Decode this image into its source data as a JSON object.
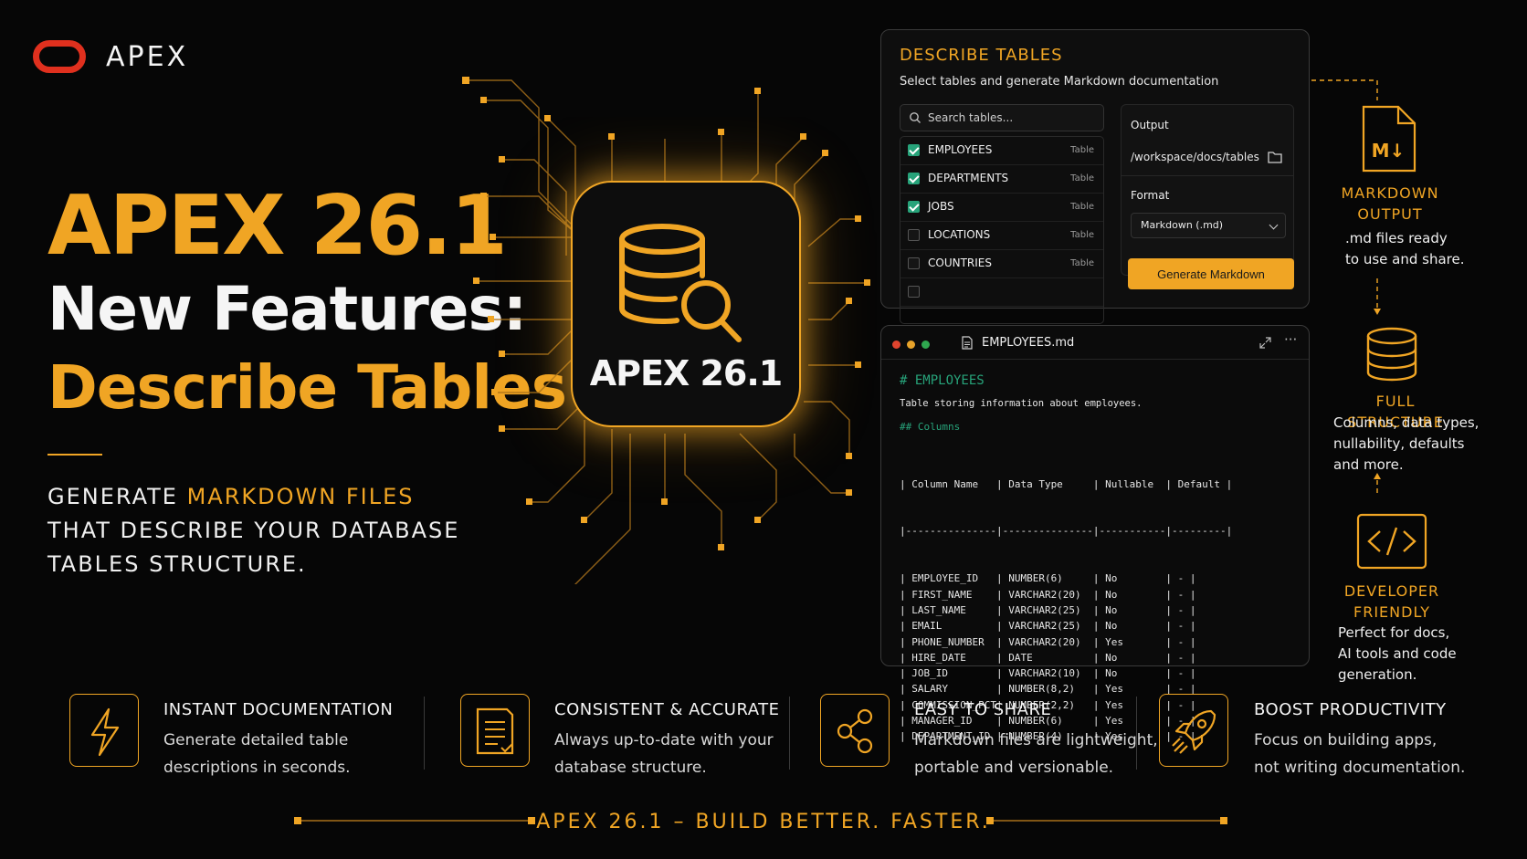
{
  "brand": {
    "logo_text": "APEX"
  },
  "hero": {
    "line1": "APEX 26.1",
    "line2": "New Features:",
    "line3": "Describe Tables",
    "subhead": {
      "l1_pre": "GENERATE ",
      "l1_accent": "MARKDOWN FILES",
      "l2": "THAT DESCRIBE YOUR DATABASE",
      "l3": "TABLES STRUCTURE."
    }
  },
  "chip": {
    "label": "APEX 26.1",
    "icon": "database-search-icon"
  },
  "describe_panel": {
    "title": "DESCRIBE TABLES",
    "subtitle": "Select tables and generate Markdown documentation",
    "search_placeholder": "Search tables...",
    "tables": [
      {
        "name": "EMPLOYEES",
        "type": "Table",
        "checked": true
      },
      {
        "name": "DEPARTMENTS",
        "type": "Table",
        "checked": true
      },
      {
        "name": "JOBS",
        "type": "Table",
        "checked": true
      },
      {
        "name": "LOCATIONS",
        "type": "Table",
        "checked": false
      },
      {
        "name": "COUNTRIES",
        "type": "Table",
        "checked": false
      }
    ],
    "output_label": "Output",
    "output_path": "/workspace/docs/tables",
    "format_label": "Format",
    "format_value": "Markdown (.md)",
    "generate_label": "Generate Markdown"
  },
  "md_panel": {
    "filename": "EMPLOYEES.md",
    "heading": "# EMPLOYEES",
    "description": "Table storing information about employees.",
    "subheading": "## Columns",
    "header_line": "| Column Name   | Data Type     | Nullable  | Default |",
    "separator_line": "|---------------|---------------|-----------|---------|",
    "rows": [
      {
        "name": "EMPLOYEE_ID",
        "type": "NUMBER(6)",
        "nullable": "No",
        "default": "-"
      },
      {
        "name": "FIRST_NAME",
        "type": "VARCHAR2(20)",
        "nullable": "No",
        "default": "-"
      },
      {
        "name": "LAST_NAME",
        "type": "VARCHAR2(25)",
        "nullable": "No",
        "default": "-"
      },
      {
        "name": "EMAIL",
        "type": "VARCHAR2(25)",
        "nullable": "No",
        "default": "-"
      },
      {
        "name": "PHONE_NUMBER",
        "type": "VARCHAR2(20)",
        "nullable": "Yes",
        "default": "-"
      },
      {
        "name": "HIRE_DATE",
        "type": "DATE",
        "nullable": "No",
        "default": "-"
      },
      {
        "name": "JOB_ID",
        "type": "VARCHAR2(10)",
        "nullable": "No",
        "default": "-"
      },
      {
        "name": "SALARY",
        "type": "NUMBER(8,2)",
        "nullable": "Yes",
        "default": "-"
      },
      {
        "name": "COMMISSION_PCT",
        "type": "NUMBER(2,2)",
        "nullable": "Yes",
        "default": "-"
      },
      {
        "name": "MANAGER_ID",
        "type": "NUMBER(6)",
        "nullable": "Yes",
        "default": "-"
      },
      {
        "name": "DEPARTMENT_ID",
        "type": "NUMBER(4)",
        "nullable": "Yes",
        "default": "-"
      }
    ]
  },
  "rail": [
    {
      "title_l1": "MARKDOWN",
      "title_l2": "OUTPUT",
      "desc": [
        ".md files ready",
        "to use and share."
      ],
      "icon": "markdown-file-icon"
    },
    {
      "title_l1": "FULL STRUCTURE",
      "title_l2": "",
      "desc": [
        "Columns, data types,",
        "nullability, defaults",
        "and more."
      ],
      "icon": "database-icon"
    },
    {
      "title_l1": "DEVELOPER",
      "title_l2": "FRIENDLY",
      "desc": [
        "Perfect for docs,",
        "AI tools and code",
        "generation."
      ],
      "icon": "code-icon"
    }
  ],
  "features": [
    {
      "title": "INSTANT DOCUMENTATION",
      "desc": [
        "Generate detailed table",
        "descriptions in seconds."
      ],
      "icon": "lightning-icon"
    },
    {
      "title": "CONSISTENT & ACCURATE",
      "desc": [
        "Always up-to-date with your",
        "database structure."
      ],
      "icon": "document-check-icon"
    },
    {
      "title": "EASY TO SHARE",
      "desc": [
        "Markdown files are lightweight,",
        "portable and versionable."
      ],
      "icon": "share-icon"
    },
    {
      "title": "BOOST PRODUCTIVITY",
      "desc": [
        "Focus on building apps,",
        "not writing documentation."
      ],
      "icon": "rocket-icon"
    }
  ],
  "tagline": "APEX 26.1 – BUILD BETTER. FASTER.",
  "colors": {
    "accent": "#f0a524",
    "brand_red": "#e0301e",
    "check_green": "#27a37a",
    "background": "#060606"
  }
}
